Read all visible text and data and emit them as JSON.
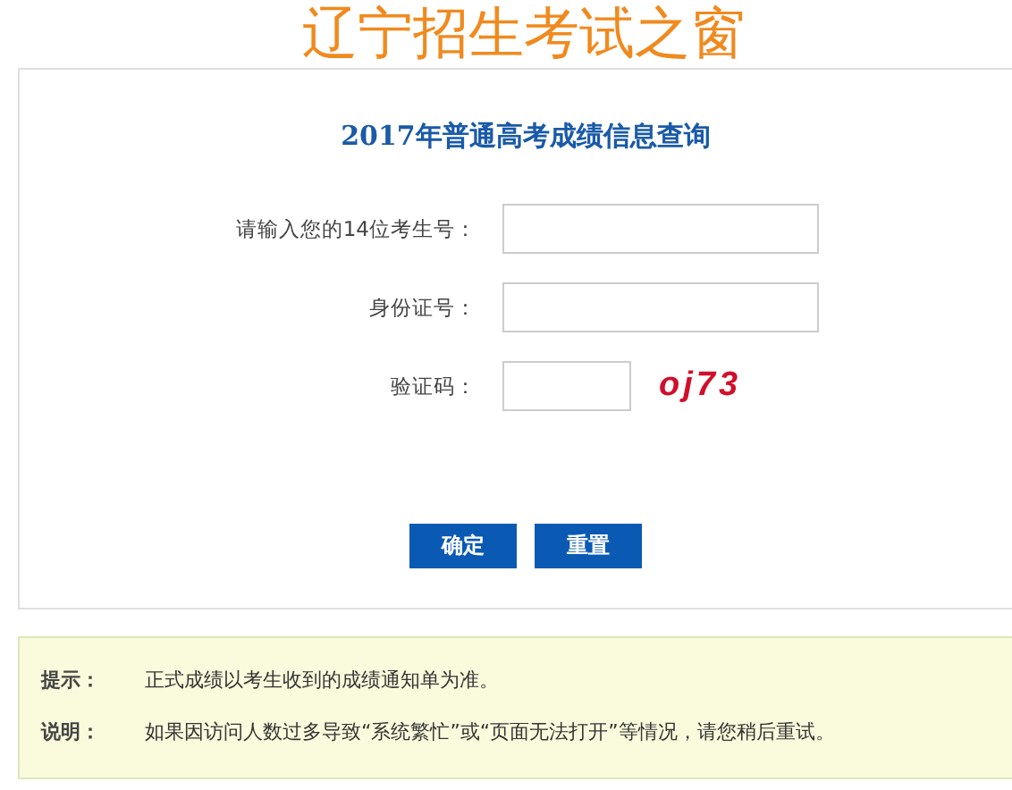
{
  "header": {
    "title": "辽宁招生考试之窗"
  },
  "form": {
    "title": "2017年普通高考成绩信息查询",
    "fields": [
      {
        "label": "请输入您的14位考生号：",
        "kind": "wide"
      },
      {
        "label": "身份证号：",
        "kind": "wide"
      },
      {
        "label": "验证码：",
        "kind": "captcha",
        "captcha": "oj73"
      }
    ],
    "buttons": [
      "确定",
      "重置"
    ]
  },
  "notes": [
    {
      "label": "提示：",
      "text": "正式成绩以考生收到的成绩通知单为准。"
    },
    {
      "label": "说明：",
      "text": "如果因访问人数过多导致“系统繁忙”或“页面无法打开”等情况，请您稍后重试。"
    }
  ]
}
